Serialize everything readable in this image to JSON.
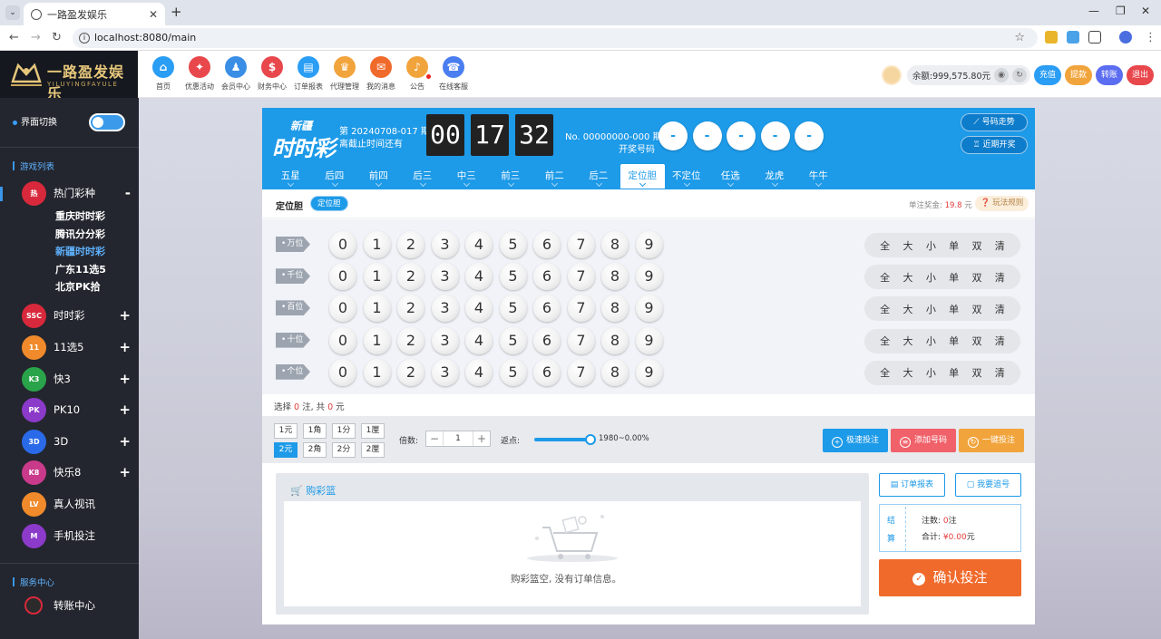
{
  "browser": {
    "tab_title": "一路盈发娱乐",
    "url": "localhost:8080/main"
  },
  "header": {
    "logo_text": "一路盈发娱乐",
    "logo_sub": "YILUYINGFAYULE",
    "nav": [
      {
        "label": "首页",
        "icon": "home-icon",
        "color": "#2a9df4"
      },
      {
        "label": "优惠活动",
        "icon": "gift-icon",
        "color": "#e8474c"
      },
      {
        "label": "会员中心",
        "icon": "member-icon",
        "color": "#3a8ee6"
      },
      {
        "label": "财务中心",
        "icon": "finance-icon",
        "color": "#e8474c"
      },
      {
        "label": "订单报表",
        "icon": "report-icon",
        "color": "#2a9df4"
      },
      {
        "label": "代理管理",
        "icon": "agent-icon",
        "color": "#f2a43c"
      },
      {
        "label": "我的消息",
        "icon": "message-icon",
        "color": "#f06a2b"
      },
      {
        "label": "公告",
        "icon": "bell-icon",
        "color": "#f2a43c"
      },
      {
        "label": "在线客服",
        "icon": "service-icon",
        "color": "#4a7ef0"
      }
    ],
    "balance": "余额:999,575.80元",
    "buttons": [
      {
        "label": "充值",
        "color": "#2a9df4"
      },
      {
        "label": "提款",
        "color": "#f2a43c"
      },
      {
        "label": "转账",
        "color": "#5b6df0"
      },
      {
        "label": "退出",
        "color": "#e8474c"
      }
    ]
  },
  "sidebar": {
    "switch_label": "界面切换",
    "games_title": "游戏列表",
    "groups": [
      {
        "label": "热门彩种",
        "toggle": "-",
        "color": "#d8283c",
        "badge": "热"
      },
      {
        "label": "时时彩",
        "toggle": "+",
        "color": "#d8283c",
        "badge": "SSC"
      },
      {
        "label": "11选5",
        "toggle": "+",
        "color": "#f08a2b",
        "badge": "11"
      },
      {
        "label": "快3",
        "toggle": "+",
        "color": "#2aa44a",
        "badge": "K3"
      },
      {
        "label": "PK10",
        "toggle": "+",
        "color": "#8b3ac9",
        "badge": "PK"
      },
      {
        "label": "3D",
        "toggle": "+",
        "color": "#2a6ae8",
        "badge": "3D"
      },
      {
        "label": "快乐8",
        "toggle": "+",
        "color": "#c93a8b",
        "badge": "K8"
      },
      {
        "label": "真人视讯",
        "toggle": "",
        "color": "#f08a2b",
        "badge": "LV"
      },
      {
        "label": "手机投注",
        "toggle": "",
        "color": "#8b3ac9",
        "badge": "M"
      }
    ],
    "hot_items": [
      {
        "label": "重庆时时彩",
        "active": false
      },
      {
        "label": "腾讯分分彩",
        "active": false
      },
      {
        "label": "新疆时时彩",
        "active": true
      },
      {
        "label": "广东11选5",
        "active": false
      },
      {
        "label": "北京PK拾",
        "active": false
      }
    ],
    "service_title": "服务中心",
    "service_items": [
      {
        "label": "转账中心",
        "color": "#d8283c"
      }
    ]
  },
  "lottery": {
    "logo_top": "新疆",
    "logo_main": "时时彩",
    "issue": "第 20240708-017 期",
    "deadline_label": "离截止时间还有",
    "countdown": [
      "00",
      "17",
      "32"
    ],
    "draw_no": "No. 00000000-000 期",
    "draw_label": "开奖号码",
    "balls": [
      "-",
      "-",
      "-",
      "-",
      "-"
    ],
    "trend_btn": "号码走势",
    "recent_btn": "近期开奖",
    "tabs": [
      "五星",
      "后四",
      "前四",
      "后三",
      "中三",
      "前三",
      "前二",
      "后二",
      "定位胆",
      "不定位",
      "任选",
      "龙虎",
      "牛牛"
    ],
    "active_tab": 8
  },
  "play": {
    "title": "定位胆",
    "sub_pill": "定位胆",
    "prize_label": "单注奖金:",
    "prize_value": "19.8",
    "prize_unit": "元",
    "rule_btn": "玩法规则",
    "rows": [
      "万位",
      "千位",
      "百位",
      "十位",
      "个位"
    ],
    "numbers": [
      "0",
      "1",
      "2",
      "3",
      "4",
      "5",
      "6",
      "7",
      "8",
      "9"
    ],
    "quick": [
      "全",
      "大",
      "小",
      "单",
      "双",
      "清"
    ]
  },
  "selection": {
    "prefix": "选择",
    "count": "0",
    "mid": "注, 共",
    "amount": "0",
    "suffix": "元"
  },
  "betbar": {
    "units_row1": [
      "1元",
      "1角",
      "1分",
      "1厘"
    ],
    "units_row2": [
      "2元",
      "2角",
      "2分",
      "2厘"
    ],
    "active_unit": "2元",
    "mult_label": "倍数:",
    "mult_value": "1",
    "rebate_label": "返点:",
    "rebate_value": "1980~0.00%",
    "rebate_position": 1.0,
    "btn_quick": "极速投注",
    "btn_add": "添加号码",
    "btn_one": "一键投注"
  },
  "cart": {
    "title": "购彩篮",
    "empty_text": "购彩篮空, 没有订单信息。",
    "order_btn": "订单报表",
    "track_btn": "我要追号",
    "settle_label": "结算",
    "count_label": "注数:",
    "count_value": "0",
    "count_unit": "注",
    "total_label": "合计:",
    "total_value": "¥0.00",
    "total_unit": "元",
    "confirm_btn": "确认投注"
  }
}
